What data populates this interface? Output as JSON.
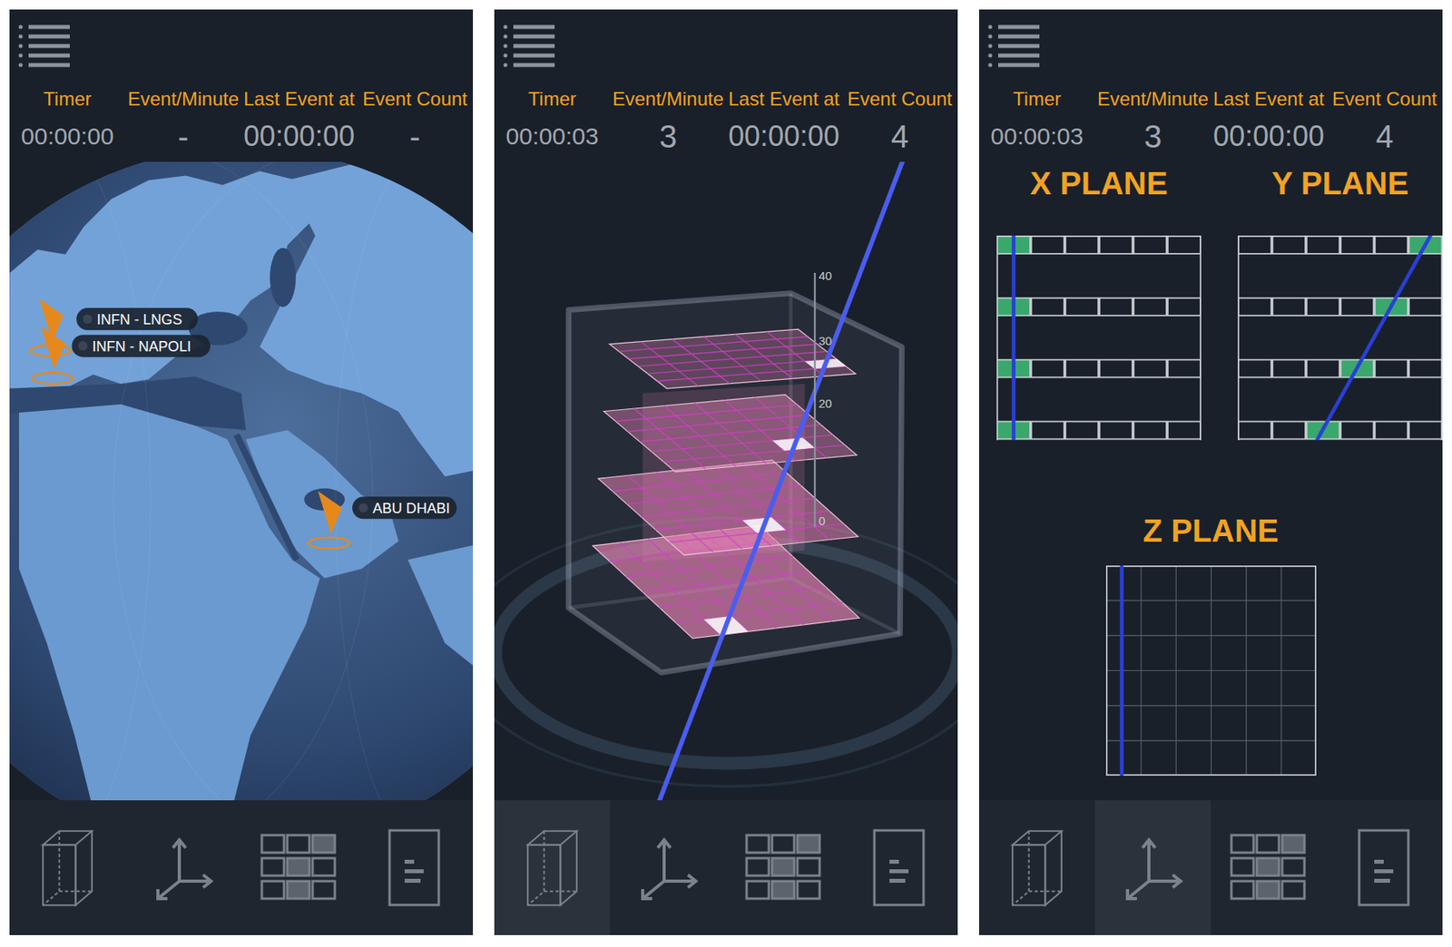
{
  "panels": [
    {
      "kind": "globe",
      "labels": [
        "Timer",
        "Event/Minute",
        "Last Event at",
        "Event Count"
      ],
      "values": [
        "00:00:00",
        "-",
        "00:00:00",
        "-"
      ],
      "sites": [
        {
          "label": "INFN - LNGS"
        },
        {
          "label": "INFN - NAPOLI"
        },
        {
          "label": "ABU DHABI"
        }
      ],
      "nav": [
        {
          "kind": "detector",
          "selected": false
        },
        {
          "kind": "axes",
          "selected": false
        },
        {
          "kind": "grid",
          "selected": false
        },
        {
          "kind": "report",
          "selected": false
        }
      ]
    },
    {
      "kind": "detector",
      "labels": [
        "Timer",
        "Event/Minute",
        "Last Event at",
        "Event Count"
      ],
      "values": [
        "00:00:03",
        "3",
        "00:00:00",
        "4"
      ],
      "axis_labels": [
        "40",
        "30",
        "20",
        "0"
      ],
      "layers": [
        {
          "hit_row": 4,
          "hit_col": 5
        },
        {
          "hit_row": 4,
          "hit_col": 4
        },
        {
          "hit_row": 4,
          "hit_col": 3
        },
        {
          "hit_row": 5,
          "hit_col": 1
        }
      ],
      "nav": [
        {
          "kind": "detector",
          "selected": true
        },
        {
          "kind": "axes",
          "selected": false
        },
        {
          "kind": "grid",
          "selected": false
        },
        {
          "kind": "report",
          "selected": false
        }
      ]
    },
    {
      "kind": "planes",
      "labels": [
        "Timer",
        "Event/Minute",
        "Last Event at",
        "Event Count"
      ],
      "values": [
        "00:00:03",
        "3",
        "00:00:00",
        "4"
      ],
      "planes": [
        {
          "title": "X PLANE",
          "hits": [
            0,
            0,
            0,
            0
          ]
        },
        {
          "title": "Y PLANE",
          "hits": [
            5,
            4,
            3,
            2
          ]
        }
      ],
      "z_plane": {
        "title": "Z PLANE",
        "track_col": 0
      },
      "nav": [
        {
          "kind": "detector",
          "selected": false
        },
        {
          "kind": "axes",
          "selected": true
        },
        {
          "kind": "grid",
          "selected": false
        },
        {
          "kind": "report",
          "selected": false
        }
      ]
    }
  ]
}
